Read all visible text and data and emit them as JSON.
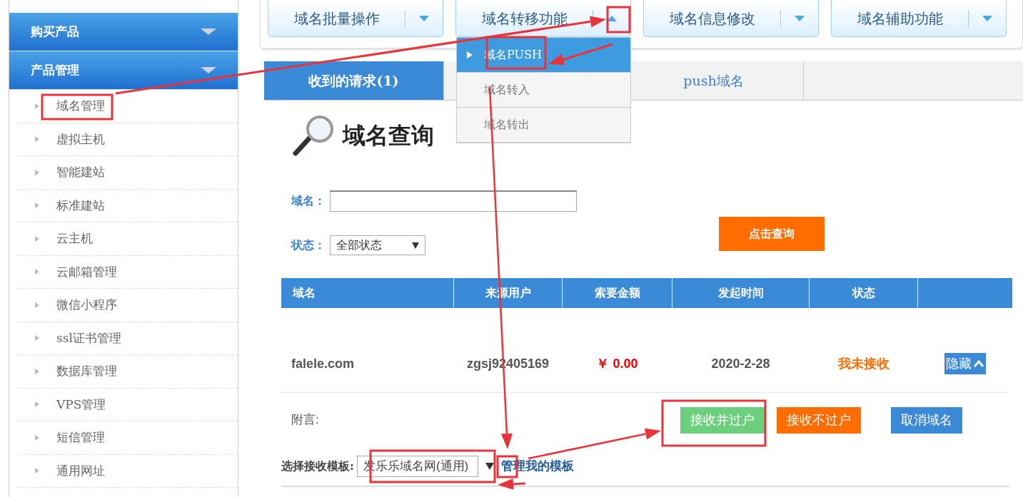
{
  "sidebar": {
    "sections": [
      {
        "label": "购买产品"
      },
      {
        "label": "产品管理"
      }
    ],
    "items": [
      {
        "label": "域名管理"
      },
      {
        "label": "虚拟主机"
      },
      {
        "label": "智能建站"
      },
      {
        "label": "标准建站"
      },
      {
        "label": "云主机"
      },
      {
        "label": "云邮箱管理"
      },
      {
        "label": "微信小程序"
      },
      {
        "label": "ssl证书管理"
      },
      {
        "label": "数据库管理"
      },
      {
        "label": "VPS管理"
      },
      {
        "label": "短信管理"
      },
      {
        "label": "通用网址"
      }
    ]
  },
  "toolbar": [
    {
      "label": "域名批量操作",
      "open": false
    },
    {
      "label": "域名转移功能",
      "open": true,
      "menu": [
        {
          "label": "域名PUSH",
          "selected": true
        },
        {
          "label": "域名转入",
          "selected": false
        },
        {
          "label": "域名转出",
          "selected": false
        }
      ]
    },
    {
      "label": "域名信息修改",
      "open": false
    },
    {
      "label": "域名辅助功能",
      "open": false
    }
  ],
  "tabs": [
    {
      "label": "收到的请求(1)",
      "selected": true
    },
    {
      "selected": false
    },
    {
      "label": "push域名",
      "selected": false
    },
    {
      "selected": false
    }
  ],
  "search": {
    "title": "域名查询",
    "domain_label": "域名：",
    "status_label": "状态：",
    "status_value": "全部状态",
    "button": "点击查询"
  },
  "table": {
    "columns": [
      "域名",
      "来源用户",
      "索要金额",
      "发起时间",
      "状态"
    ],
    "rows": [
      {
        "domain": "falele.com",
        "user": "zgsj92405169",
        "amount": "￥ 0.00",
        "date": "2020-2-28",
        "status": "我未接收",
        "action": "隐藏"
      }
    ]
  },
  "note_label": "附言:",
  "actions": [
    {
      "label": "接收并过户",
      "kind": "success"
    },
    {
      "label": "接收不过户",
      "kind": "warning"
    },
    {
      "label": "取消域名",
      "kind": "primary"
    }
  ],
  "template": {
    "label": "选择接收模板:",
    "value": "发乐乐域名网(通用)",
    "link": "管理我的模板"
  }
}
